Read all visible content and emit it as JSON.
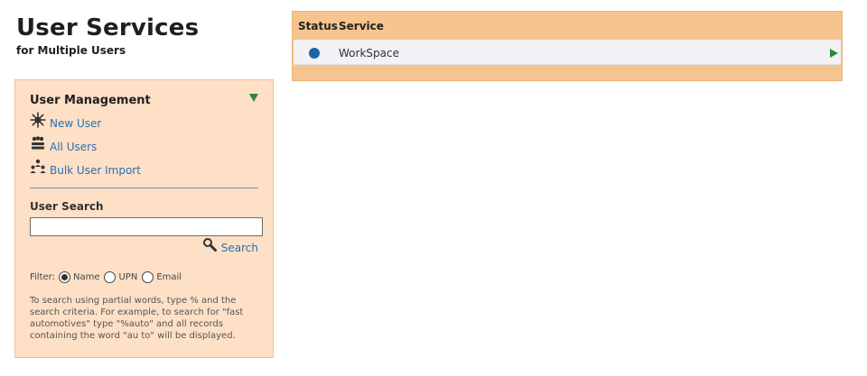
{
  "header": {
    "title": "User Services",
    "subtitle": "for Multiple Users"
  },
  "user_management": {
    "title": "User Management",
    "toggle_icon": "triangle-down-icon",
    "items": [
      {
        "label": "New User",
        "icon": "starburst-icon"
      },
      {
        "label": "All Users",
        "icon": "users-stack-icon"
      },
      {
        "label": "Bulk User Import",
        "icon": "group-import-icon"
      }
    ]
  },
  "user_search": {
    "title": "User Search",
    "input_value": "",
    "search_label": "Search",
    "search_icon": "magnifier-icon",
    "filter_label": "Filter:",
    "filter_options": [
      {
        "label": "Name",
        "selected": true
      },
      {
        "label": "UPN",
        "selected": false
      },
      {
        "label": "Email",
        "selected": false
      }
    ],
    "help_text": "To search using partial words, type % and the search criteria. For example, to search for \"fast automotives\" type \"%auto\" and all records containing the word \"au to\" will be displayed."
  },
  "services": {
    "columns": {
      "status": "Status",
      "service": "Service"
    },
    "rows": [
      {
        "status": "active",
        "name": "WorkSpace"
      }
    ]
  },
  "colors": {
    "panel_bg": "#fde0c6",
    "services_bg": "#f6c48e",
    "link": "#2a6fb0",
    "status_dot": "#1f66a0",
    "arrow": "#2b8a3e"
  }
}
